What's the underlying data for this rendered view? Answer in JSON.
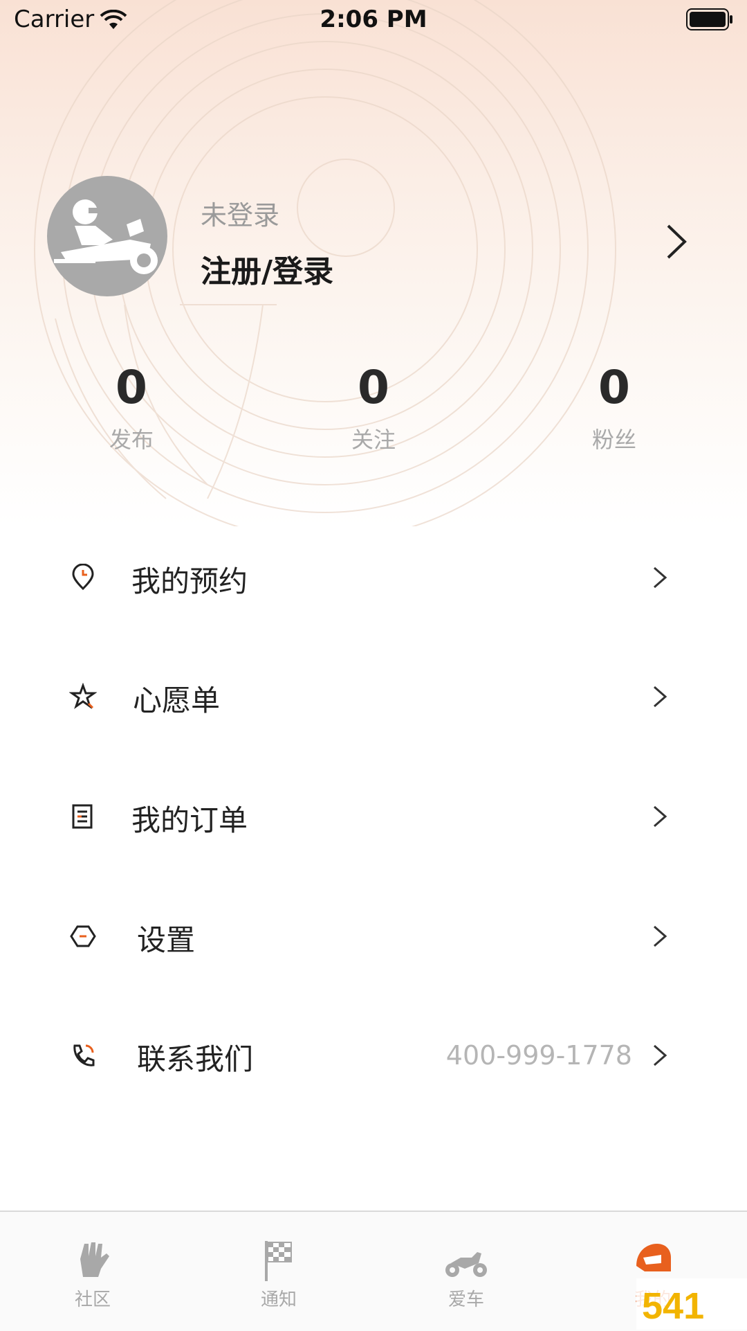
{
  "status_bar": {
    "carrier": "Carrier",
    "time": "2:06 PM"
  },
  "profile": {
    "login_status": "未登录",
    "login_link": "注册/登录"
  },
  "stats": [
    {
      "value": "0",
      "label": "发布"
    },
    {
      "value": "0",
      "label": "关注"
    },
    {
      "value": "0",
      "label": "粉丝"
    }
  ],
  "menu": [
    {
      "label": "我的预约",
      "icon": "clock-pin-icon"
    },
    {
      "label": "心愿单",
      "icon": "star-icon"
    },
    {
      "label": "我的订单",
      "icon": "order-list-icon"
    },
    {
      "label": "设置",
      "icon": "settings-hexagon-icon"
    },
    {
      "label": "联系我们",
      "icon": "phone-icon",
      "value": "400-999-1778"
    }
  ],
  "tabs": [
    {
      "label": "社区",
      "icon": "glove-icon",
      "active": false
    },
    {
      "label": "通知",
      "icon": "checkered-flag-icon",
      "active": false
    },
    {
      "label": "爱车",
      "icon": "motorcycle-icon",
      "active": false
    },
    {
      "label": "我的",
      "icon": "helmet-icon",
      "active": true
    }
  ],
  "colors": {
    "accent": "#e8601e",
    "tab_inactive": "#a8a8a8",
    "header_gradient": "#f9e1d4"
  }
}
